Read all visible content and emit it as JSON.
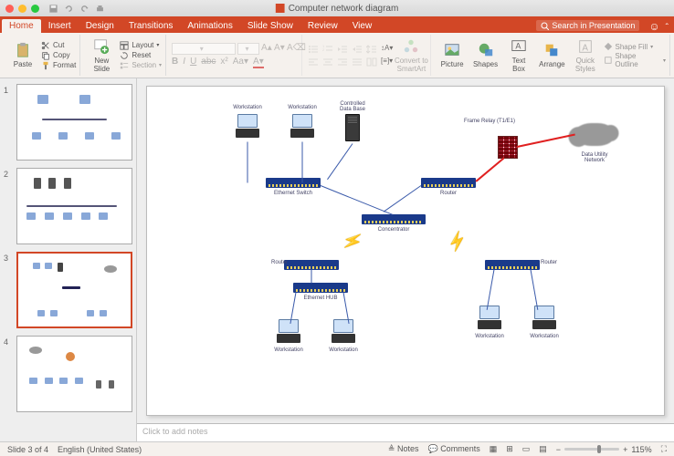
{
  "doc": {
    "title": "Computer network diagram"
  },
  "search": {
    "placeholder": "Search in Presentation"
  },
  "tabs": {
    "home": "Home",
    "insert": "Insert",
    "design": "Design",
    "transitions": "Transitions",
    "animations": "Animations",
    "slideshow": "Slide Show",
    "review": "Review",
    "view": "View"
  },
  "ribbon": {
    "paste": "Paste",
    "cut": "Cut",
    "copy": "Copy",
    "format": "Format",
    "new_slide": "New\nSlide",
    "layout": "Layout",
    "reset": "Reset",
    "section": "Section",
    "convert_smartart": "Convert to\nSmartArt",
    "picture": "Picture",
    "shapes": "Shapes",
    "text_box": "Text\nBox",
    "arrange": "Arrange",
    "quick_styles": "Quick\nStyles",
    "shape_fill": "Shape Fill",
    "shape_outline": "Shape Outline"
  },
  "notes_placeholder": "Click to add notes",
  "status": {
    "slide": "Slide 3 of 4",
    "lang": "English (United States)",
    "notes": "Notes",
    "comments": "Comments",
    "zoom": "115%"
  },
  "diagram": {
    "workstation": "Workstation",
    "controlled_db": "Controlled\nData Base",
    "frame_relay": "Frame Relay (T1/E1)",
    "data_utility": "Data Utility\nNetwork",
    "ethernet_switch": "Ethernet Switch",
    "router": "Router",
    "concentrator": "Concentrator",
    "ethernet_hub": "Ethernet HUB"
  }
}
